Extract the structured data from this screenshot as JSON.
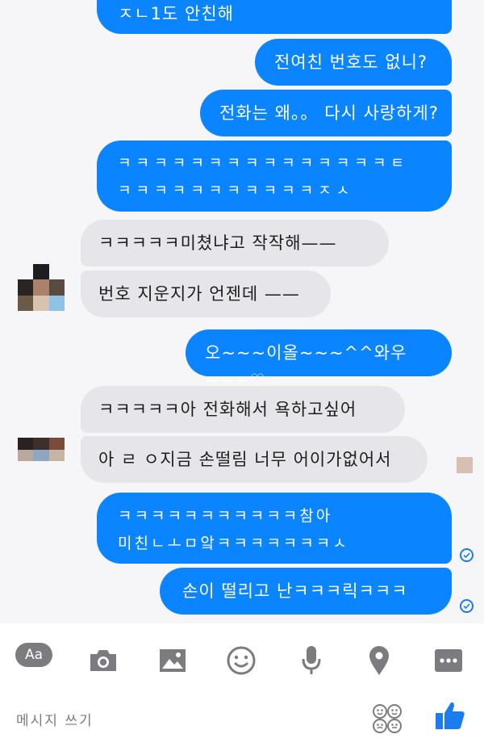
{
  "messages": [
    {
      "dir": "out",
      "text": "ㅈㄴ1도 안친해"
    },
    {
      "dir": "out",
      "text": "전여친 번호도 없니?"
    },
    {
      "dir": "out",
      "text": "전화는 왜。。 다시 사랑하게?"
    },
    {
      "dir": "out",
      "text": "ㅋㅋㅋㅋㅋㅋㅋㅋㅋㅋㅋㅋㅋㅋㅋㅌ\nㅋㅋㅋㅋㅋㅋㅋㅋㅋㅋㅋㅈㅅ"
    },
    {
      "dir": "in",
      "text": "ㅋㅋㅋㅋㅋ미쳤냐고 작작해——"
    },
    {
      "dir": "in",
      "text": "번호 지운지가 언젠데 ——"
    },
    {
      "dir": "out",
      "text": "오~~~이올~~~^^와우~~~♡"
    },
    {
      "dir": "in",
      "text": "ㅋㅋㅋㅋㅋ아 전화해서 욕하고싶어"
    },
    {
      "dir": "in",
      "text": "아 ㄹ ㅇ지금 손떨림 너무 어이가없어서"
    },
    {
      "dir": "out",
      "text": "ㅋㅋㅋㅋㅋㅋㅋㅋㅋㅋㅋ참아\n미친ㄴㅗㅁ앜ㅋㅋㅋㅋㅋㅋㅋㅅ"
    },
    {
      "dir": "out",
      "text": "손이 떨리고 난ㅋㅋㅋ릭ㅋㅋㅋ"
    }
  ],
  "composer": {
    "aa_label": "Aa",
    "placeholder": "메시지 쓰기",
    "icons": [
      "text-format-icon",
      "camera-icon",
      "image-icon",
      "emoji-icon",
      "microphone-icon",
      "location-icon",
      "more-icon",
      "sticker-icon",
      "like-icon"
    ]
  },
  "colors": {
    "outgoing": "#0a84ff",
    "incoming": "#e6e6ea",
    "accent": "#1a7cf0"
  }
}
